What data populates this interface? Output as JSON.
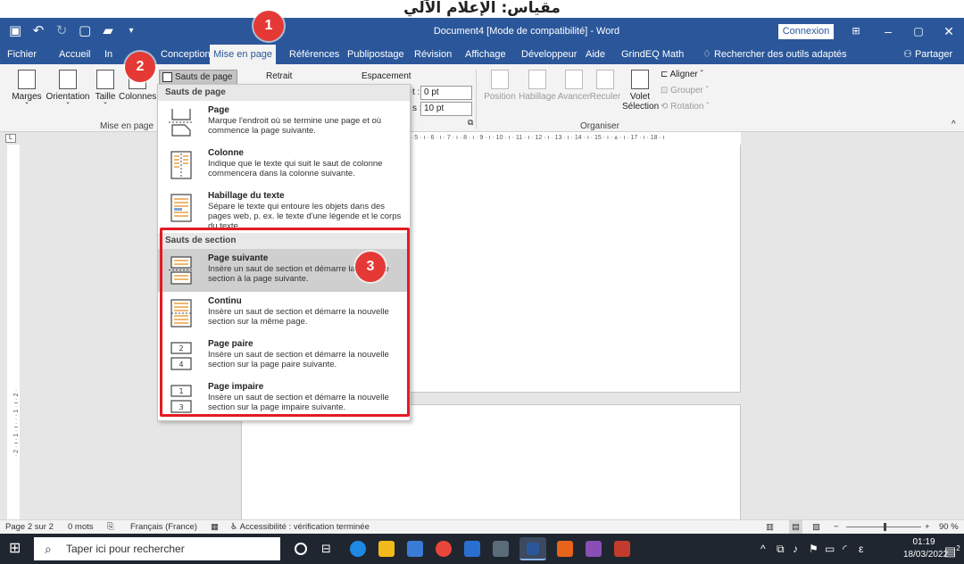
{
  "caption": "مقياس: الإعلام الآلي",
  "titlebar": {
    "doc_title": "Document4 [Mode de compatibilité] - Word",
    "connexion": "Connexion"
  },
  "tabs": [
    "Fichier",
    "Accueil",
    "In",
    "Conception",
    "Mise en page",
    "Références",
    "Publipostage",
    "Révision",
    "Affichage",
    "Développeur",
    "Aide",
    "GrindEQ Math"
  ],
  "search_tab": "Rechercher des outils adaptés",
  "partager": "Partager",
  "ribbon": {
    "marges": "Marges",
    "orientation": "Orientation",
    "taille": "Taille",
    "colonnes": "Colonnes",
    "group_mise_en_page": "Mise en page",
    "sauts_de_page": "Sauts de page",
    "retrait": "Retrait",
    "espacement": "Espacement",
    "espacement_avant_label": "t :",
    "espacement_avant": "0 pt",
    "espacement_apres_label": "s :",
    "espacement_apres": "10 pt",
    "position": "Position",
    "habillage": "Habillage",
    "avancer": "Avancer",
    "reculer": "Reculer",
    "volet_line1": "Volet",
    "volet_line2": "Sélection",
    "aligner": "Aligner",
    "grouper": "Grouper",
    "rotation": "Rotation",
    "group_organiser": "Organiser"
  },
  "ruler_text": "· 5 · ı · 6 · ı · 7 · ı · 8 · ı · 9 · ı · 10 · ı · 11 · ı · 12 · ı · 13 · ı · 14 · ı · 15 · ı · ⩓ · ı · 17 · ı · 18 · ı",
  "vruler_text": "· 2 · ı · 1 · ı · · · 1 · ı · 2 ·",
  "dropdown": {
    "header_page": "Sauts de page",
    "header_section": "Sauts de section",
    "items_page": [
      {
        "title": "Page",
        "desc": "Marque l'endroit où se termine une page et où commence la page suivante."
      },
      {
        "title": "Colonne",
        "desc": "Indique que le texte qui suit le saut de colonne commencera dans la colonne suivante."
      },
      {
        "title": "Habillage du texte",
        "desc": "Sépare le texte qui entoure les objets dans des pages web, p. ex. le texte d'une légende et le corps du texte."
      }
    ],
    "items_section": [
      {
        "title": "Page suivante",
        "desc": "Insère un saut de section et démarre la nouvelle section à la page suivante."
      },
      {
        "title": "Continu",
        "desc": "Insère un saut de section et démarre la nouvelle section sur la même page."
      },
      {
        "title": "Page paire",
        "desc": "Insère un saut de section et démarre la nouvelle section sur la page paire suivante."
      },
      {
        "title": "Page impaire",
        "desc": "Insère un saut de section et démarre la nouvelle section sur la page impaire suivante."
      }
    ]
  },
  "badges": {
    "one": "1",
    "two": "2",
    "three": "3"
  },
  "status": {
    "page": "Page 2 sur 2",
    "words": "0 mots",
    "language": "Français (France)",
    "accessibility": "Accessibilité : vérification terminée",
    "zoom": "90 %"
  },
  "taskbar": {
    "search_placeholder": "Taper ici pour rechercher",
    "time": "01:19",
    "date": "18/03/2022",
    "notification_count": "2",
    "lang_indicator": "ε"
  },
  "colors": {
    "word_blue": "#2b579a",
    "highlight_red": "#e31b23",
    "badge_red": "#e53935"
  }
}
